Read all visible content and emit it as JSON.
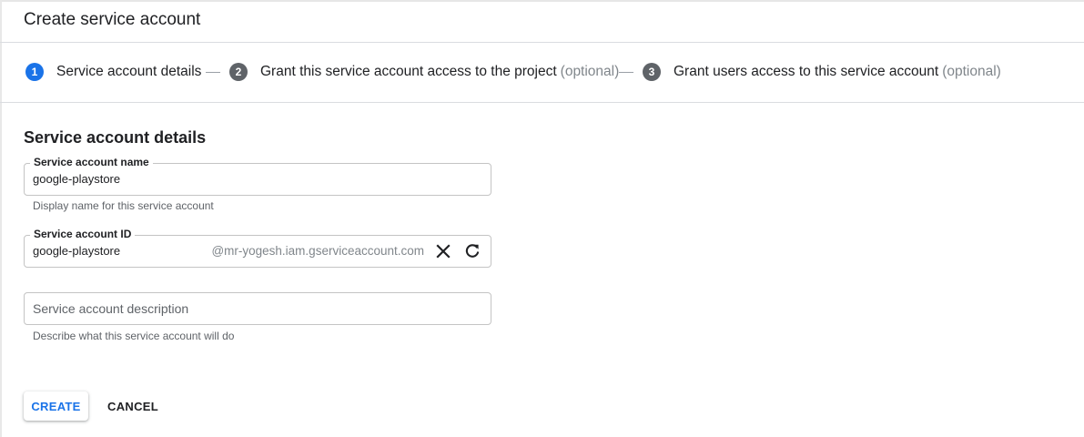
{
  "header": {
    "title": "Create service account"
  },
  "stepper": {
    "steps": [
      {
        "number": "1",
        "label": "Service account details",
        "optional": "",
        "state": "active"
      },
      {
        "number": "2",
        "label": "Grant this service account access to the project",
        "optional": "(optional)",
        "state": "inactive"
      },
      {
        "number": "3",
        "label": "Grant users access to this service account",
        "optional": "(optional)",
        "state": "inactive"
      }
    ]
  },
  "form": {
    "section_title": "Service account details",
    "name_field": {
      "label": "Service account name",
      "value": "google-playstore",
      "hint": "Display name for this service account"
    },
    "id_field": {
      "label": "Service account ID",
      "value": "google-playstore",
      "suffix": "@mr-yogesh.iam.gserviceaccount.com",
      "clear_icon": "close-icon",
      "refresh_icon": "refresh-icon"
    },
    "description_field": {
      "placeholder": "Service account description",
      "value": "",
      "hint": "Describe what this service account will do"
    }
  },
  "actions": {
    "create_label": "CREATE",
    "cancel_label": "CANCEL"
  },
  "colors": {
    "accent": "#1a73e8",
    "inactive_step": "#5f6368",
    "border": "#dadce0"
  }
}
